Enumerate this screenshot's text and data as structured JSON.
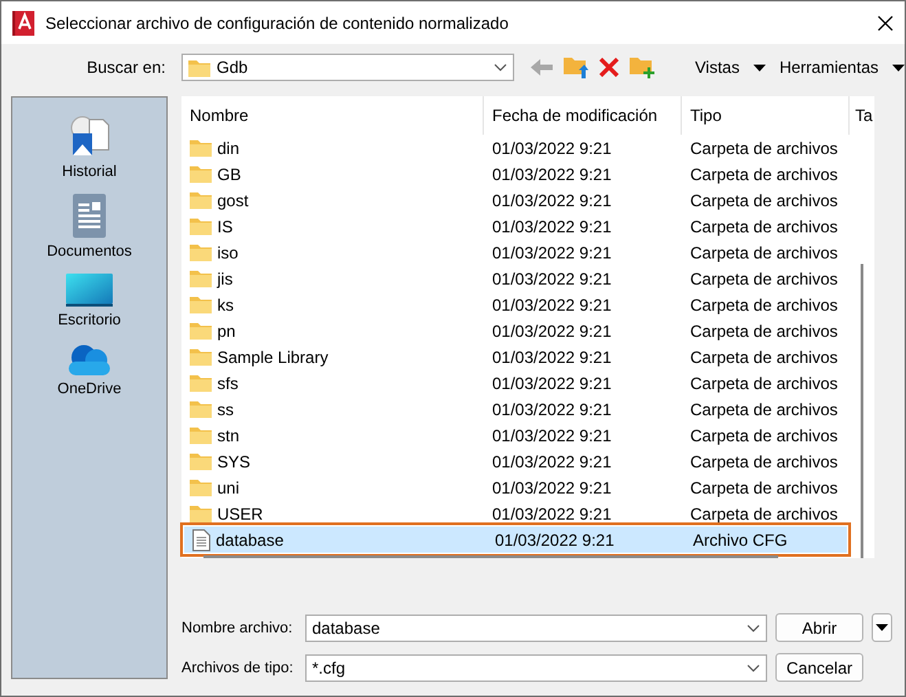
{
  "window": {
    "title": "Seleccionar archivo de configuración de contenido normalizado"
  },
  "toolbar": {
    "look_in_label": "Buscar en:",
    "look_in_value": "Gdb",
    "views": "Vistas",
    "tools": "Herramientas"
  },
  "places": [
    {
      "label": "Historial",
      "kind": "history"
    },
    {
      "label": "Documentos",
      "kind": "documents"
    },
    {
      "label": "Escritorio",
      "kind": "desktop"
    },
    {
      "label": "OneDrive",
      "kind": "cloud"
    }
  ],
  "table": {
    "columns": [
      "Nombre",
      "Fecha de modificación",
      "Tipo",
      "Ta"
    ],
    "rows": [
      {
        "name": "din",
        "date": "01/03/2022 9:21",
        "type": "Carpeta de archivos",
        "kind": "folder",
        "selected": false
      },
      {
        "name": "GB",
        "date": "01/03/2022 9:21",
        "type": "Carpeta de archivos",
        "kind": "folder",
        "selected": false
      },
      {
        "name": "gost",
        "date": "01/03/2022 9:21",
        "type": "Carpeta de archivos",
        "kind": "folder",
        "selected": false
      },
      {
        "name": "IS",
        "date": "01/03/2022 9:21",
        "type": "Carpeta de archivos",
        "kind": "folder",
        "selected": false
      },
      {
        "name": "iso",
        "date": "01/03/2022 9:21",
        "type": "Carpeta de archivos",
        "kind": "folder",
        "selected": false
      },
      {
        "name": "jis",
        "date": "01/03/2022 9:21",
        "type": "Carpeta de archivos",
        "kind": "folder",
        "selected": false
      },
      {
        "name": "ks",
        "date": "01/03/2022 9:21",
        "type": "Carpeta de archivos",
        "kind": "folder",
        "selected": false
      },
      {
        "name": "pn",
        "date": "01/03/2022 9:21",
        "type": "Carpeta de archivos",
        "kind": "folder",
        "selected": false
      },
      {
        "name": "Sample Library",
        "date": "01/03/2022 9:21",
        "type": "Carpeta de archivos",
        "kind": "folder",
        "selected": false
      },
      {
        "name": "sfs",
        "date": "01/03/2022 9:21",
        "type": "Carpeta de archivos",
        "kind": "folder",
        "selected": false
      },
      {
        "name": "ss",
        "date": "01/03/2022 9:21",
        "type": "Carpeta de archivos",
        "kind": "folder",
        "selected": false
      },
      {
        "name": "stn",
        "date": "01/03/2022 9:21",
        "type": "Carpeta de archivos",
        "kind": "folder",
        "selected": false
      },
      {
        "name": "SYS",
        "date": "01/03/2022 9:21",
        "type": "Carpeta de archivos",
        "kind": "folder",
        "selected": false
      },
      {
        "name": "uni",
        "date": "01/03/2022 9:21",
        "type": "Carpeta de archivos",
        "kind": "folder",
        "selected": false
      },
      {
        "name": "USER",
        "date": "01/03/2022 9:21",
        "type": "Carpeta de archivos",
        "kind": "folder",
        "selected": false
      },
      {
        "name": "database",
        "date": "01/03/2022 9:21",
        "type": "Archivo CFG",
        "kind": "file",
        "selected": true
      }
    ]
  },
  "file_name": {
    "label": "Nombre archivo:",
    "value": "database"
  },
  "file_type": {
    "label": "Archivos de tipo:",
    "value": "*.cfg"
  },
  "buttons": [
    "Abrir",
    "Cancelar"
  ]
}
